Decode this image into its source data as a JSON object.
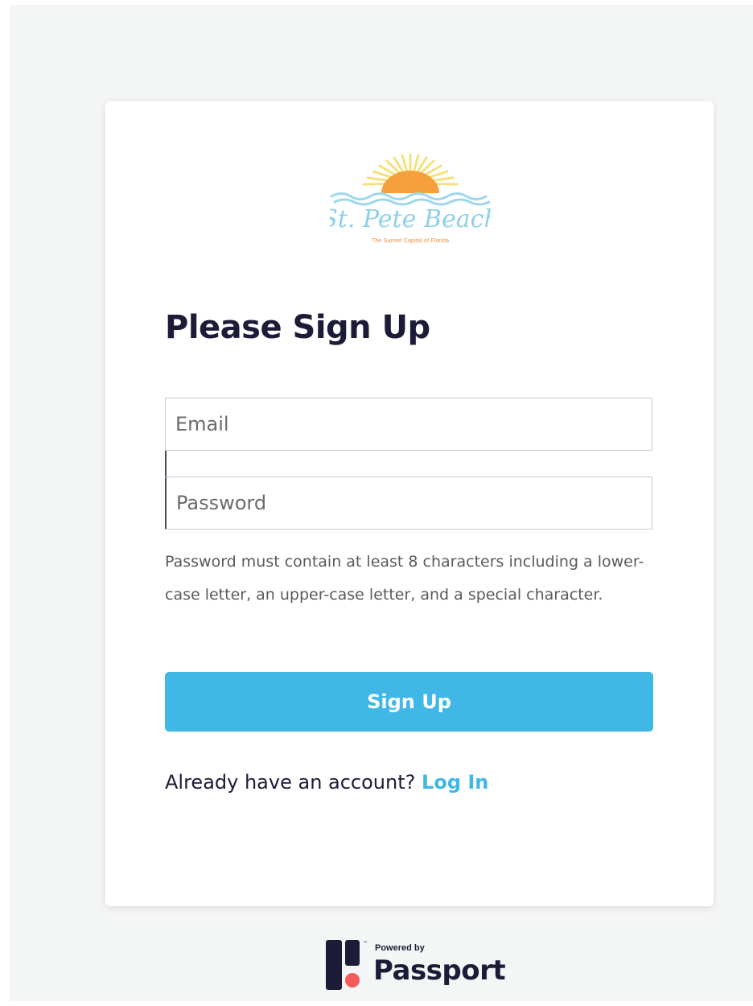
{
  "logo": {
    "name": "St. Pete Beach",
    "tagline": "The Sunset Capital of Florida"
  },
  "form": {
    "heading": "Please Sign Up",
    "email_placeholder": "Email",
    "password_placeholder": "Password",
    "password_hint": "Password must contain at least 8 characters including a lower-case letter, an upper-case letter, and a special character.",
    "submit_label": "Sign Up",
    "login_prompt": "Already have an account?",
    "login_link": "Log In"
  },
  "footer": {
    "powered_by": "Powered by",
    "brand": "Passport"
  },
  "colors": {
    "accent": "#40b7e5",
    "heading": "#1c1c38",
    "sun": "#f5a03c",
    "sun_rays": "#f7e07a",
    "waves": "#9fd6ee",
    "passport_dot": "#f45b5b"
  }
}
